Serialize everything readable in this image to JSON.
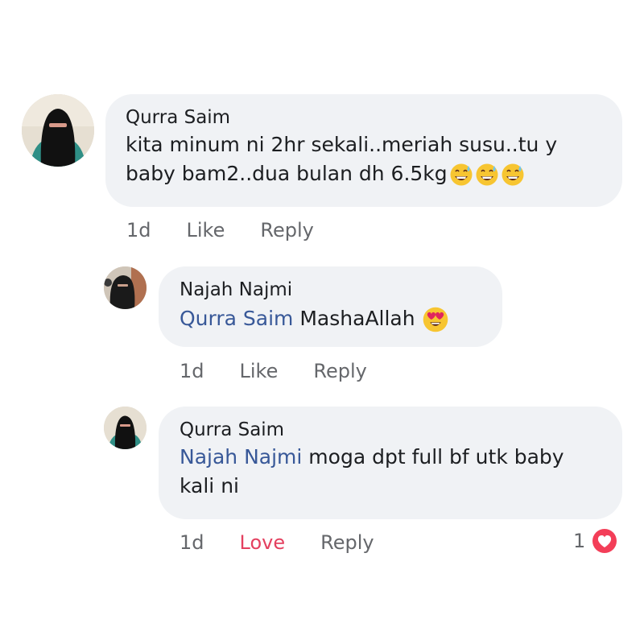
{
  "comments": [
    {
      "author": "Qurra Saim",
      "mention": "",
      "text_line1": "kita minum ni 2hr sekali..meriah susu..tu y",
      "text_line2": "baby bam2..dua bulan dh 6.5kg",
      "emoji": "grinning-sweat-emoji",
      "time": "1d",
      "like_label": "Like",
      "reply_label": "Reply"
    },
    {
      "author": "Najah Najmi",
      "mention": "Qurra Saim",
      "text": "MashaAllah",
      "emoji": "heart-eyes-emoji",
      "time": "1d",
      "like_label": "Like",
      "reply_label": "Reply"
    },
    {
      "author": "Qurra Saim",
      "mention": "Najah Najmi",
      "text_line1": "moga dpt full bf utk baby",
      "text_line2": "kali ni",
      "time": "1d",
      "reaction_label": "Love",
      "reply_label": "Reply",
      "reaction_count": "1",
      "reaction_icon": "heart-icon"
    }
  ],
  "colors": {
    "bubble": "#f0f2f5",
    "mention": "#385898",
    "love": "#e4405f",
    "meta": "#65676b"
  }
}
